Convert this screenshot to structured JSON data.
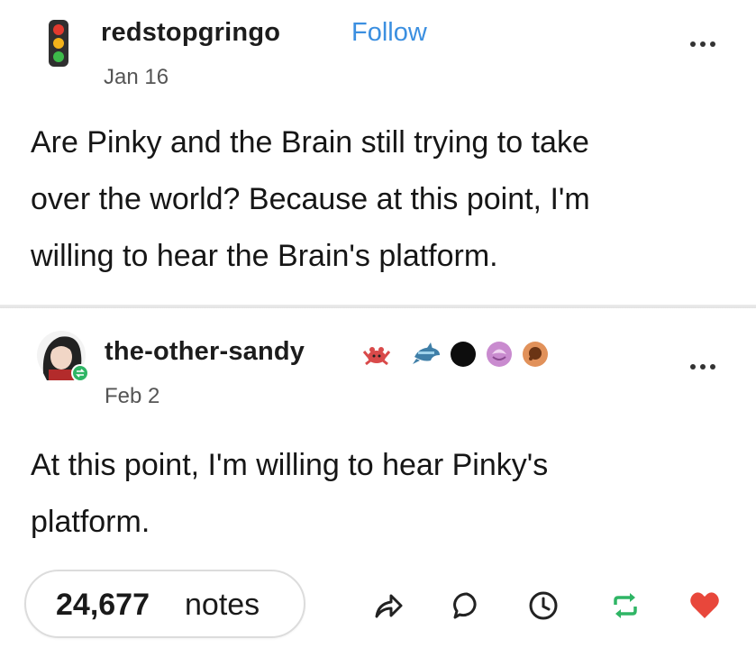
{
  "post_1": {
    "username": "redstopgringo",
    "follow_label": "Follow",
    "date": "Jan 16",
    "text_lines": [
      "Are Pinky and the Brain still trying to take",
      "over the world? Because at this point, I'm",
      "willing to hear the Brain's platform."
    ]
  },
  "post_2": {
    "username": "the-other-sandy",
    "date": "Feb 2",
    "text_lines": [
      "At this point, I'm willing to hear Pinky's",
      "platform."
    ],
    "badges": [
      "crab-badge",
      "dolphin-badge",
      "black-circle-badge",
      "purple-brain-badge",
      "orange-cookie-badge"
    ]
  },
  "footer": {
    "notes_count": "24,677",
    "notes_label": "notes",
    "actions": [
      "share-icon",
      "reply-icon",
      "clock-icon",
      "reblog-icon",
      "heart-icon"
    ]
  },
  "colors": {
    "follow": "#3b8fe0",
    "reblog": "#2fb565",
    "heart": "#e8473b"
  }
}
